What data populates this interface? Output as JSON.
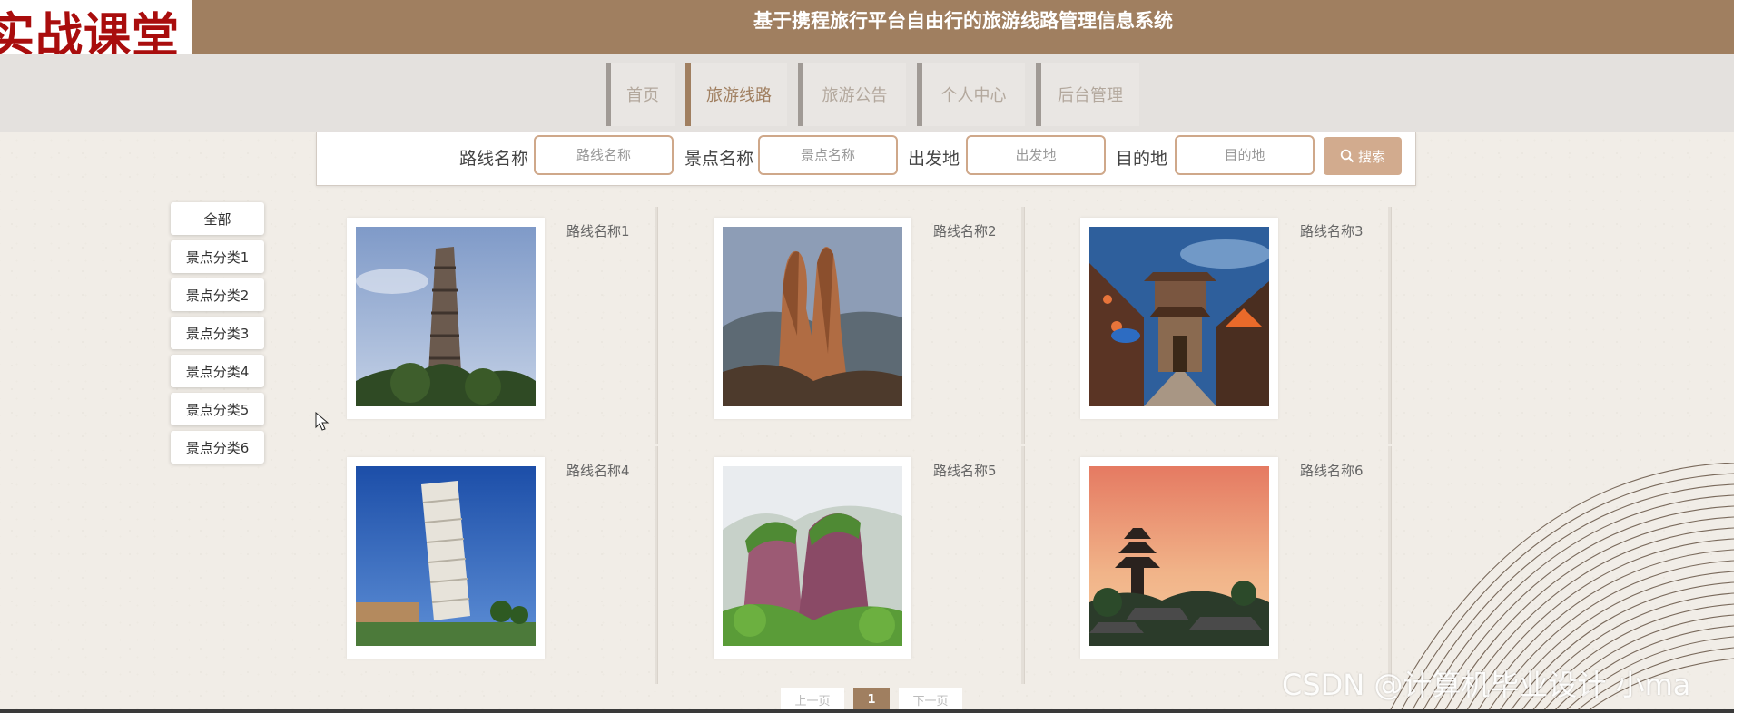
{
  "header": {
    "logo_text": "实战课堂",
    "title": "基于携程旅行平台自由行的旅游线路管理信息系统"
  },
  "nav": {
    "items": [
      {
        "label": "首页",
        "active": false
      },
      {
        "label": "旅游线路",
        "active": true
      },
      {
        "label": "旅游公告",
        "active": false
      },
      {
        "label": "个人中心",
        "active": false
      },
      {
        "label": "后台管理",
        "active": false
      }
    ]
  },
  "search": {
    "fields": [
      {
        "label": "路线名称",
        "placeholder": "路线名称",
        "value": ""
      },
      {
        "label": "景点名称",
        "placeholder": "景点名称",
        "value": ""
      },
      {
        "label": "出发地",
        "placeholder": "出发地",
        "value": ""
      },
      {
        "label": "目的地",
        "placeholder": "目的地",
        "value": ""
      }
    ],
    "button_label": "搜索",
    "button_icon": "search-icon"
  },
  "categories": [
    "全部",
    "景点分类1",
    "景点分类2",
    "景点分类3",
    "景点分类4",
    "景点分类5",
    "景点分类6"
  ],
  "routes": [
    {
      "name": "路线名称1",
      "image": "stone-pagoda-photo"
    },
    {
      "name": "路线名称2",
      "image": "rock-pillars-photo"
    },
    {
      "name": "路线名称3",
      "image": "old-town-street-photo"
    },
    {
      "name": "路线名称4",
      "image": "leaning-tower-photo"
    },
    {
      "name": "路线名称5",
      "image": "green-cliff-photo"
    },
    {
      "name": "路线名称6",
      "image": "pagoda-sunset-photo"
    }
  ],
  "pagination": {
    "prev_label": "上一页",
    "current": "1",
    "next_label": "下一页"
  },
  "watermark": "CSDN @计算机毕业设计 小ma",
  "colors": {
    "header": "#a07f60",
    "accent": "#d2ab8e",
    "logo_text": "#a90d0d"
  }
}
